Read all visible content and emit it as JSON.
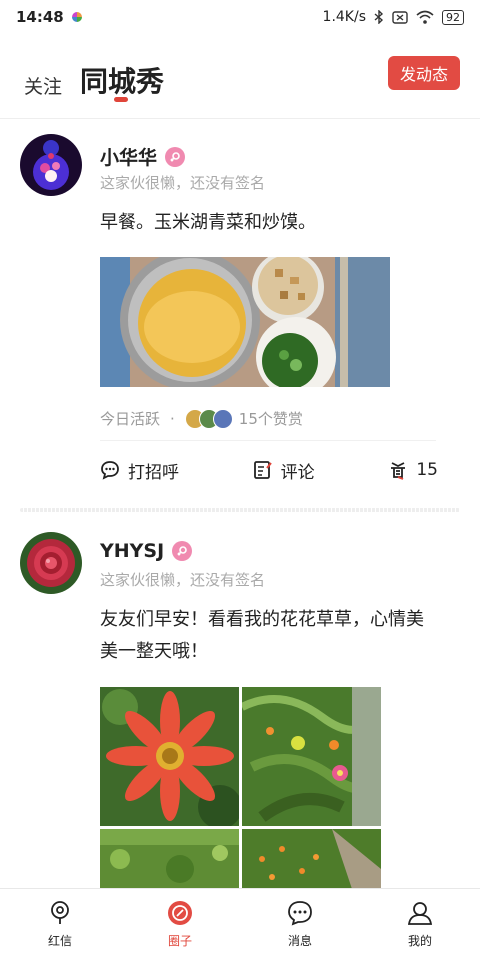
{
  "status_bar": {
    "time": "14:48",
    "network_speed": "1.4K/s",
    "battery": "92"
  },
  "header": {
    "tab_follow": "关注",
    "tab_local": "同城秀",
    "post_button": "发动态"
  },
  "posts": [
    {
      "username": "小华华",
      "signature": "这家伙很懒，还没有签名",
      "content": "早餐。玉米湖青菜和炒馍。",
      "activity": "今日活跃",
      "likes": "15个赞赏",
      "actions": {
        "greet": "打招呼",
        "comment": "评论",
        "reward_count": "15"
      }
    },
    {
      "username": "YHYSJ",
      "signature": "这家伙很懒，还没有签名",
      "content": "友友们早安！看看我的花花草草，心情美美一整天哦！"
    }
  ],
  "bottom_nav": [
    {
      "label": "红信",
      "icon": "location-pin-icon"
    },
    {
      "label": "圈子",
      "icon": "circle-compass-icon"
    },
    {
      "label": "消息",
      "icon": "chat-bubble-icon"
    },
    {
      "label": "我的",
      "icon": "person-icon"
    }
  ],
  "colors": {
    "accent": "#e24b43",
    "gender_female": "#f08ab0"
  }
}
